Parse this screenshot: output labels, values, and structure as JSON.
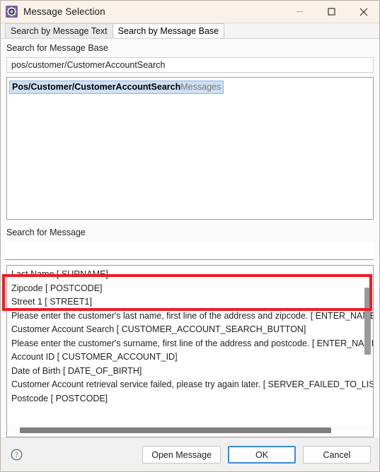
{
  "window": {
    "title": "Message Selection",
    "icon": "gear-icon",
    "controls": {
      "minimize": "minimize-icon",
      "maximize": "maximize-icon",
      "close": "close-icon"
    }
  },
  "tabs": [
    {
      "label": "Search by Message Text",
      "active": false
    },
    {
      "label": "Search by Message Base",
      "active": true
    }
  ],
  "message_base": {
    "label": "Search for Message Base",
    "input_value": "pos/customer/CustomerAccountSearch",
    "input_placeholder": "",
    "results": [
      {
        "bold": "Pos/Customer/CustomerAccountSearch",
        "dim": "Messages",
        "selected": true
      }
    ]
  },
  "message_search": {
    "label": "Search for Message",
    "input_value": "",
    "input_placeholder": ""
  },
  "messages": [
    "Last Name [ SURNAME]",
    "Zipcode [ POSTCODE]",
    "Street 1 [ STREET1]",
    "Please enter the customer's last name, first line of the address and zipcode. [ ENTER_NAME_PR",
    "Customer Account Search [ CUSTOMER_ACCOUNT_SEARCH_BUTTON]",
    "Please enter the customer's surname, first line of the address and postcode. [ ENTER_NAME_PR",
    "Account ID [ CUSTOMER_ACCOUNT_ID]",
    "Date of Birth [ DATE_OF_BIRTH]",
    "Customer Account retrieval service failed, please try again later. [ SERVER_FAILED_TO_LIST]",
    "Postcode [ POSTCODE]"
  ],
  "footer": {
    "help": "help-icon",
    "open_message": "Open Message",
    "ok": "OK",
    "cancel": "Cancel"
  },
  "annotation": {
    "color": "#ee1c25"
  }
}
